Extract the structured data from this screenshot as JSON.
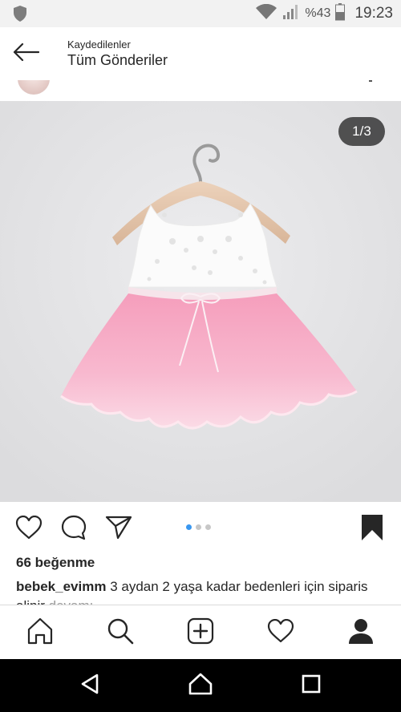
{
  "status_bar": {
    "battery_percent": "%43",
    "time": "19:23"
  },
  "header": {
    "subtitle": "Kaydedilenler",
    "title": "Tüm Gönderiler"
  },
  "post": {
    "image_counter": "1/3",
    "carousel": {
      "count": 3,
      "active_index": 0
    },
    "likes": "66 beğenme",
    "caption_user": "bebek_evimm",
    "caption_text": "3 aydan 2 yaşa kadar bedenleri için siparis alinir",
    "caption_more": "devamı"
  },
  "icons": {
    "status_left": "shield-icon",
    "back": "arrow-left-icon",
    "like": "heart-icon",
    "comment": "comment-bubble-icon",
    "share": "paper-plane-icon",
    "save": "bookmark-filled-icon",
    "nav_home": "home-icon",
    "nav_search": "search-icon",
    "nav_add": "plus-square-icon",
    "nav_activity": "heart-icon",
    "nav_profile": "person-icon"
  },
  "colors": {
    "accent": "#3897f0",
    "dress_pink": "#f7b8cd",
    "image_background": "#e3e3e5"
  }
}
